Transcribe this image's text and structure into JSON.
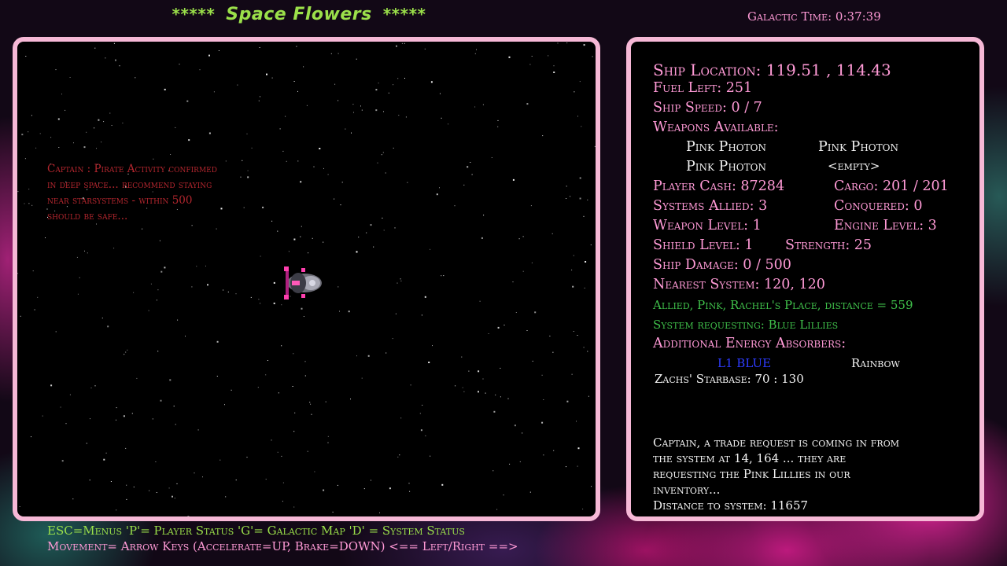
{
  "header": {
    "title": "Space Flowers",
    "stars_left": "*****",
    "stars_right": "*****",
    "galactic_time": "Galactic Time: 0:37:39"
  },
  "left_panel": {
    "pirate_message": [
      "Captain : Pirate Activity confirmed",
      "in deep space... recommend staying",
      "near starsystems - within 500",
      "should be safe..."
    ],
    "ship_icon": "player-ship-sprite"
  },
  "status": {
    "ship_location": "Ship Location: 119.51 ,  114.43",
    "fuel_left": "Fuel Left: 251",
    "ship_speed": "Ship Speed: 0  /  7",
    "weapons_label": "Weapons Available:",
    "weapons": [
      "Pink Photon",
      "Pink Photon",
      "Pink Photon",
      "<empty>"
    ],
    "player_cash": "Player Cash: 87284",
    "cargo": "Cargo:  201 / 201",
    "systems_allied": "Systems Allied: 3",
    "conquered": "Conquered: 0",
    "weapon_level": "Weapon Level: 1",
    "engine_level": "Engine Level: 3",
    "shield_level": "Shield Level: 1",
    "strength": "Strength: 25",
    "ship_damage": "Ship Damage: 0  /  500",
    "nearest_system": "Nearest System: 120, 120",
    "allied_info": "Allied, Pink, Rachel's Place, distance = 559",
    "system_request": "System requesting: Blue Lillies",
    "energy_label": "Additional Energy Absorbers:",
    "energy_absorbers": [
      "L1 BLUE",
      "Rainbow"
    ],
    "starbase": "Zachs' Starbase: 70 : 130"
  },
  "trade_message": [
    "Captain, a trade request is coming in from",
    "the system at 14, 164 ... they are",
    "requesting the Pink Lillies in our",
    "inventory...",
    "Distance to system: 11657"
  ],
  "footer": {
    "line1": "ESC=Menus   'P'= Player Status  'G'= Galactic Map  'D' = System Status",
    "line2": "Movement= Arrow Keys (Accelerate=UP, Brake=DOWN)   <== Left/Right ==>"
  },
  "colors": {
    "pink_text": "#ff9ad6",
    "green_text": "#9be04a",
    "panel_border": "#f6b8d6",
    "warning_red": "#b3262e",
    "allied_green": "#3fbf4a",
    "absorber_blue": "#2e3cff"
  }
}
